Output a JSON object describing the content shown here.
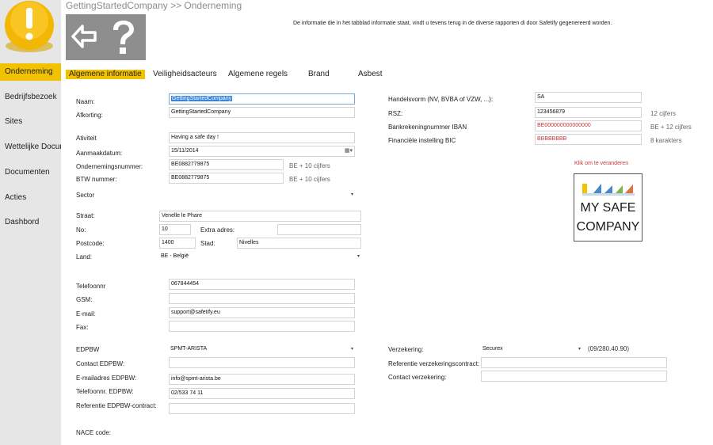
{
  "breadcrumb": "GettingStartedCompany >> Onderneming",
  "info_text": "De informatie die in het tabblad informatie staat, vindt u tevens terug in de diverse rapporten di door Safetify gegenereerd worden.",
  "sidebar": {
    "items": [
      {
        "label": "Onderneming",
        "active": true
      },
      {
        "label": "Bedrijfsbezoek"
      },
      {
        "label": "Sites"
      },
      {
        "label": "Wettelijke Documenten"
      },
      {
        "label": "Documenten"
      },
      {
        "label": "Acties"
      },
      {
        "label": "Dashbord"
      }
    ]
  },
  "toolbar": {
    "back_icon": "back-arrow-icon",
    "help_icon": "question-mark-icon"
  },
  "tabs": [
    {
      "label": "Algemene informatie",
      "active": true
    },
    {
      "label": "Veiligheidsacteurs"
    },
    {
      "label": "Algemene regels"
    },
    {
      "label": "Brand"
    },
    {
      "label": "Asbest"
    }
  ],
  "form": {
    "naam": {
      "label": "Naam:",
      "value": "GettingStartedCompany"
    },
    "afkorting": {
      "label": "Afkorting:",
      "value": "GettingStartedCompany"
    },
    "activiteit": {
      "label": "Ativiteit",
      "value": "Having a safe day !"
    },
    "aanmaakdatum": {
      "label": "Aanmaakdatum:",
      "value": "15/11/2014"
    },
    "ondernemingsnummer": {
      "label": "Ondernemingsnummer:",
      "value": "BE0882779875",
      "hint": "BE + 10 cijfers"
    },
    "btw": {
      "label": "BTW nummer:",
      "value": "BE0882779875",
      "hint": "BE + 10 cijfers"
    },
    "sector": {
      "label": "Sector",
      "value": ""
    },
    "straat": {
      "label": "Straat:",
      "value": "Venelle le Phare"
    },
    "no": {
      "label": "No:",
      "value": "10"
    },
    "extra_adres": {
      "label": "Extra adres:",
      "value": ""
    },
    "postcode": {
      "label": "Postcode:",
      "value": "1400"
    },
    "stad": {
      "label": "Stad:",
      "value": "Nivelles"
    },
    "land": {
      "label": "Land:",
      "value": "BE - België"
    },
    "telefoonnr": {
      "label": "Telefoonnr",
      "value": "067844454"
    },
    "gsm": {
      "label": "GSM:",
      "value": ""
    },
    "email": {
      "label": "E-mail:",
      "value": "support@safetify.eu"
    },
    "fax": {
      "label": "Fax:",
      "value": ""
    },
    "edpbw": {
      "label": "EDPBW",
      "value": "SPMT-ARISTA"
    },
    "contact_edpbw": {
      "label": "Contact EDPBW:",
      "value": ""
    },
    "email_edpbw": {
      "label": "E-mailadres EDPBW:",
      "value": "info@spmt-arista.be"
    },
    "tel_edpbw": {
      "label": "Telefoonnr. EDPBW:",
      "value": "02/533 74 11"
    },
    "ref_edpbw": {
      "label": "Referentie EDPBW-contract:",
      "value": ""
    },
    "nace": {
      "label": "NACE code:"
    },
    "handelsvorm": {
      "label": "Handelsvorm (NV, BVBA of VZW, ...):",
      "value": "SA"
    },
    "rsz": {
      "label": "RSZ:",
      "value": "123456879",
      "hint": "12 cijfers"
    },
    "iban": {
      "label": "Bankrekeningnummer IBAN",
      "value": "BE000000000000000",
      "hint": "BE + 12 cijfers"
    },
    "bic": {
      "label": "Financiële instelling BIC",
      "value": "BBBBBBBB",
      "hint": "8 karakters"
    },
    "verzekering": {
      "label": "Verzekering:",
      "value": "Securex",
      "phone": "(09/280.40.90)"
    },
    "ref_verzekering": {
      "label": "Referentie verzekeringscontract:",
      "value": ""
    },
    "contact_verzekering": {
      "label": "Contact verzekering:",
      "value": ""
    }
  },
  "logo_panel": {
    "change_link": "Klik om te veranderen",
    "logo_line1": "MY SAFE",
    "logo_line2": "COMPANY"
  }
}
